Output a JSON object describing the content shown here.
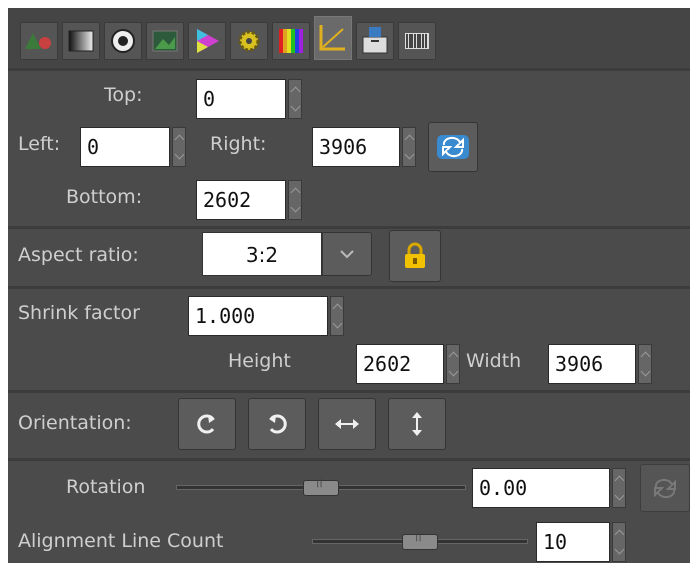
{
  "tabs": [
    {
      "name": "exposure-tab",
      "icon": "exposure-icon"
    },
    {
      "name": "bw-tab",
      "icon": "black-white-icon"
    },
    {
      "name": "detail-tab",
      "icon": "lens-icon"
    },
    {
      "name": "color-tab",
      "icon": "picture-icon"
    },
    {
      "name": "advanced-tab",
      "icon": "color-triangle-icon"
    },
    {
      "name": "raw-tab",
      "icon": "gear-icon"
    },
    {
      "name": "wavelet-tab",
      "icon": "spectrum-icon"
    },
    {
      "name": "transform-tab",
      "icon": "crop-angle-icon"
    },
    {
      "name": "metadata-tab",
      "icon": "save-icon"
    },
    {
      "name": "barcode-tab",
      "icon": "barcode-icon"
    }
  ],
  "crop": {
    "top_label": "Top:",
    "top_value": "0",
    "left_label": "Left:",
    "left_value": "0",
    "right_label": "Right:",
    "right_value": "3906",
    "bottom_label": "Bottom:",
    "bottom_value": "2602"
  },
  "aspect": {
    "label": "Aspect ratio:",
    "value": "3:2"
  },
  "resize": {
    "shrink_label": "Shrink factor",
    "shrink_value": "1.000",
    "height_label": "Height",
    "height_value": "2602",
    "width_label": "Width",
    "width_value": "3906"
  },
  "orientation": {
    "label": "Orientation:"
  },
  "rotation": {
    "label": "Rotation",
    "value": "0.00",
    "slider_fraction": 0.5
  },
  "alignment": {
    "label": "Alignment Line Count",
    "value": "10",
    "slider_fraction": 0.5
  },
  "colors": {
    "panel": "#4b4b4b",
    "field": "#ffffff",
    "lock": "#e6b800"
  }
}
